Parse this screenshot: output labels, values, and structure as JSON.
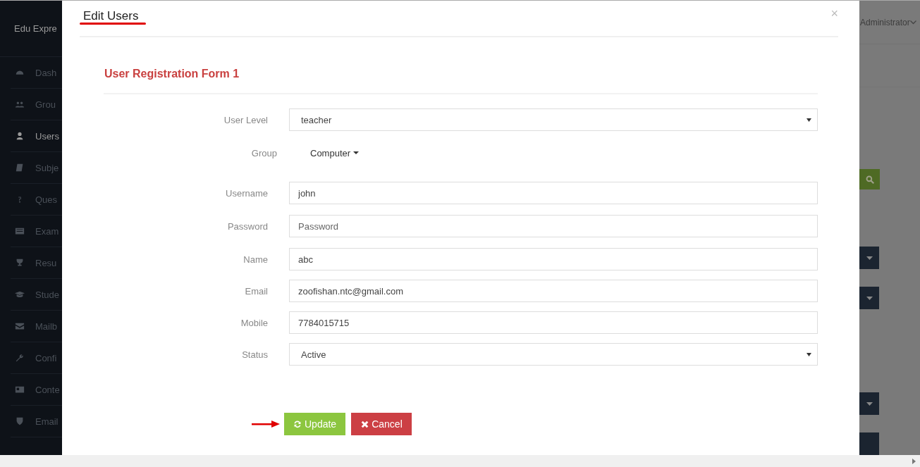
{
  "app": {
    "brand": "Edu Expre",
    "user_menu": "Administrator"
  },
  "sidebar": {
    "items": [
      {
        "label": "Dash",
        "selected": false
      },
      {
        "label": "Grou",
        "selected": false
      },
      {
        "label": "Users",
        "selected": true
      },
      {
        "label": "Subje",
        "selected": false
      },
      {
        "label": "Ques",
        "selected": false
      },
      {
        "label": "Exam",
        "selected": false
      },
      {
        "label": "Resu",
        "selected": false
      },
      {
        "label": "Stude",
        "selected": false
      },
      {
        "label": "Mailb",
        "selected": false
      },
      {
        "label": "Confi",
        "selected": false
      },
      {
        "label": "Conte",
        "selected": false
      },
      {
        "label": "Email",
        "selected": false
      }
    ]
  },
  "modal": {
    "title": "Edit Users",
    "close": "×",
    "form_title": "User Registration Form 1",
    "fields": [
      {
        "label": "User Level",
        "kind": "select",
        "value": "teacher"
      },
      {
        "label": "Group",
        "kind": "dropdown",
        "value": "Computer"
      },
      {
        "label": "Username",
        "kind": "input",
        "value": "john"
      },
      {
        "label": "Password",
        "kind": "input",
        "placeholder": "Password"
      },
      {
        "label": "Name",
        "kind": "input",
        "value": "abc"
      },
      {
        "label": "Email",
        "kind": "input",
        "value": "zoofishan.ntc@gmail.com"
      },
      {
        "label": "Mobile",
        "kind": "input",
        "value": "7784015715"
      },
      {
        "label": "Status",
        "kind": "select",
        "value": "Active"
      }
    ],
    "buttons": [
      {
        "label": "Update",
        "kind": "primary"
      },
      {
        "label": "Cancel",
        "kind": "danger"
      }
    ]
  }
}
